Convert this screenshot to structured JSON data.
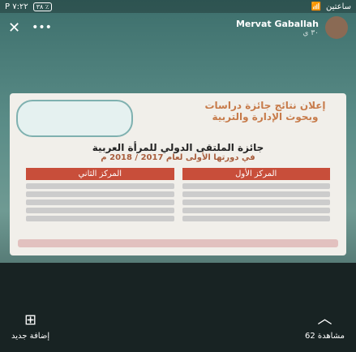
{
  "status": {
    "signal": "P ٧:٢٢",
    "battery": "٣٨ ٪",
    "icons": [
      "camera-icon",
      "alarm-icon",
      "wifi-icon",
      "signal-icon"
    ],
    "right": "ساعتين"
  },
  "header": {
    "user_name": "Mervat Gaballah",
    "user_sub": "٣٠ ي",
    "close_icon": "close-icon",
    "menu_icon": "menu-icon"
  },
  "post": {
    "announce": "إعلان نتائج جائزة دراسات وبحوث الإدارة والتربية",
    "subtitle": "جائزة الملتقى الدولي للمرأة العربية",
    "year": "في دورتها الأولى لعام 2017 / 2018 م",
    "places": [
      {
        "title": "المركز الأول"
      },
      {
        "title": "المركز الثاني"
      }
    ]
  },
  "bottom": {
    "add_new": "إضافة جديد",
    "count": "62 مشاهدة"
  }
}
